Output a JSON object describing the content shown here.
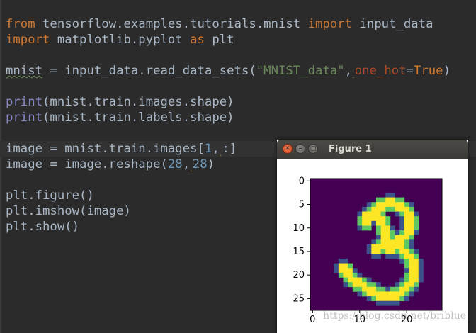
{
  "editor": {
    "lines": {
      "l1": {
        "kw1": "from",
        "mod": " tensorflow.examples.tutorials.mnist ",
        "kw2": "import",
        "name": " input_data"
      },
      "l2": {
        "kw1": "import",
        "mod": " matplotlib.pyplot ",
        "kw2": "as",
        "name": " plt"
      },
      "l4": {
        "var": "mnist",
        "a": " = input_data.read_data_sets(",
        "str": "\"MNIST_data\"",
        "comma": ",",
        "kwarg": "one_hot",
        "eq": "=",
        "kw": "True",
        "end": ")"
      },
      "l6": {
        "fn": "print",
        "rest": "(mnist.train.images.shape)"
      },
      "l7": {
        "fn": "print",
        "rest": "(mnist.train.labels.shape)"
      },
      "l9": {
        "a": "image = mnist.train.images[",
        "num": "1",
        "comma": ",",
        "b": ":]"
      },
      "l10": {
        "a": "image = image.reshape(",
        "num1": "28",
        "comma": ",",
        "num2": "28",
        "b": ")"
      },
      "l12": {
        "text": "plt.figure()"
      },
      "l13": {
        "text": "plt.imshow(image)"
      },
      "l14": {
        "text": "plt.show()"
      }
    }
  },
  "figure_window": {
    "title": "Figure 1",
    "close_icon": "close-icon",
    "minimize_icon": "minimize-icon",
    "maximize_icon": "maximize-icon"
  },
  "image_plot": {
    "y_ticks": [
      "0",
      "5",
      "10",
      "15",
      "20",
      "25"
    ],
    "x_ticks": [
      "0",
      "10",
      "20"
    ],
    "colors": {
      "background": "#440154",
      "high": "#fde725",
      "mid_teal": "#21918c",
      "mid_blue": "#3b528b",
      "mid_green": "#5ec962"
    }
  },
  "watermark": "https://blog.csdn.net/briblue"
}
